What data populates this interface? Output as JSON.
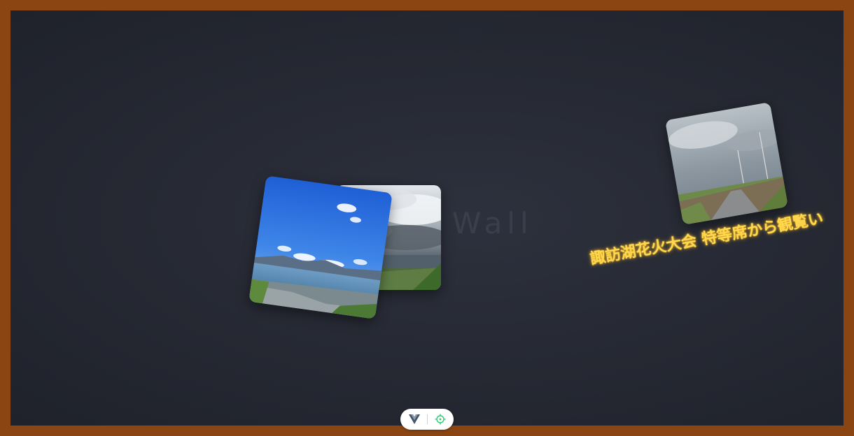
{
  "wall": {
    "title": "Love Wall",
    "background_color": "#272a34",
    "frame_color": "#8B4513"
  },
  "photos": [
    {
      "name": "storm-clouds-field",
      "subject": "cloudy sky over green field"
    },
    {
      "name": "lake-view",
      "subject": "blue sky over lake and mountains"
    },
    {
      "name": "country-road",
      "subject": "overcast sky over rural road"
    }
  ],
  "caption": {
    "text": "諏訪湖花火大会 特等席から観覧い",
    "color": "#ffd84d"
  },
  "toolbar": {
    "buttons": [
      {
        "icon": "vue-logo-icon"
      },
      {
        "icon": "crosshair-icon"
      }
    ],
    "accent": "#2ecc71"
  }
}
